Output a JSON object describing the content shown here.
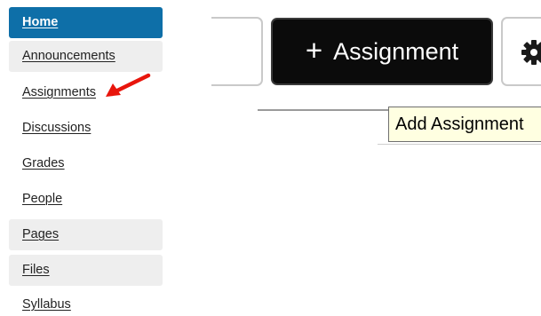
{
  "sidebar": {
    "items": [
      {
        "label": "Home"
      },
      {
        "label": "Announcements"
      },
      {
        "label": "Assignments"
      },
      {
        "label": "Discussions"
      },
      {
        "label": "Grades"
      },
      {
        "label": "People"
      },
      {
        "label": "Pages"
      },
      {
        "label": "Files"
      },
      {
        "label": "Syllabus"
      }
    ],
    "active_color": "#0e6fa8",
    "annotation_arrow_color": "#e8150c"
  },
  "toolbar": {
    "add_assignment_label": "Assignment",
    "add_icon": "plus-icon",
    "settings_icon": "gear-icon"
  },
  "tooltip": {
    "text": "Add Assignment"
  }
}
